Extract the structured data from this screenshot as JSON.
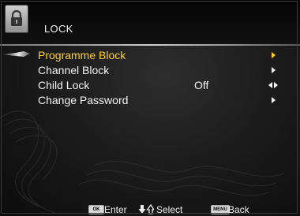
{
  "header": {
    "title": "LOCK",
    "icon": "lock-icon"
  },
  "menu": {
    "items": [
      {
        "label": "Programme Block",
        "value": "",
        "indicator": "right-arrow",
        "selected": true
      },
      {
        "label": "Channel Block",
        "value": "",
        "indicator": "right-arrow",
        "selected": false
      },
      {
        "label": "Child Lock",
        "value": "Off",
        "indicator": "left-right-arrows",
        "selected": false
      },
      {
        "label": "Change Password",
        "value": "",
        "indicator": "right-arrow",
        "selected": false
      }
    ]
  },
  "footer": {
    "ok_key": "OK",
    "enter_label": "Enter",
    "select_label": "Select",
    "menu_key": "MENU",
    "back_label": "Back"
  },
  "colors": {
    "highlight_text": "#ffd12a",
    "text": "#f4f4f4",
    "background": "#1c1c1c"
  }
}
